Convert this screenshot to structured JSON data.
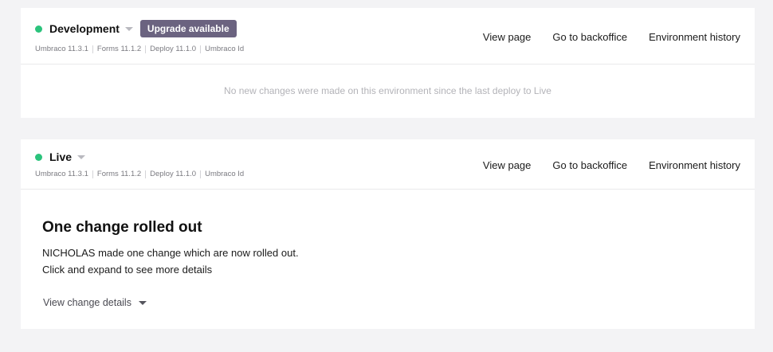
{
  "environments": {
    "dev": {
      "name": "Development",
      "badge": "Upgrade available",
      "versions": [
        "Umbraco 11.3.1",
        "Forms 11.1.2",
        "Deploy 11.1.0",
        "Umbraco Id"
      ],
      "links": [
        "View page",
        "Go to backoffice",
        "Environment history"
      ],
      "message": "No new changes were made on this environment since the last deploy to Live",
      "status_color": "#2bc37c"
    },
    "live": {
      "name": "Live",
      "versions": [
        "Umbraco 11.3.1",
        "Forms 11.1.2",
        "Deploy 11.1.0",
        "Umbraco Id"
      ],
      "links": [
        "View page",
        "Go to backoffice",
        "Environment history"
      ],
      "rollout_title": "One change rolled out",
      "rollout_line1": "NICHOLAS made one change which are now rolled out.",
      "rollout_line2": "Click and expand to see more details",
      "details_label": "View change details",
      "status_color": "#2bc37c"
    }
  },
  "colors": {
    "badge": "#6b6380",
    "background": "#f3f3f5"
  },
  "icons": {
    "status": "status-dot-icon",
    "dropdown": "chevron-down-icon"
  }
}
